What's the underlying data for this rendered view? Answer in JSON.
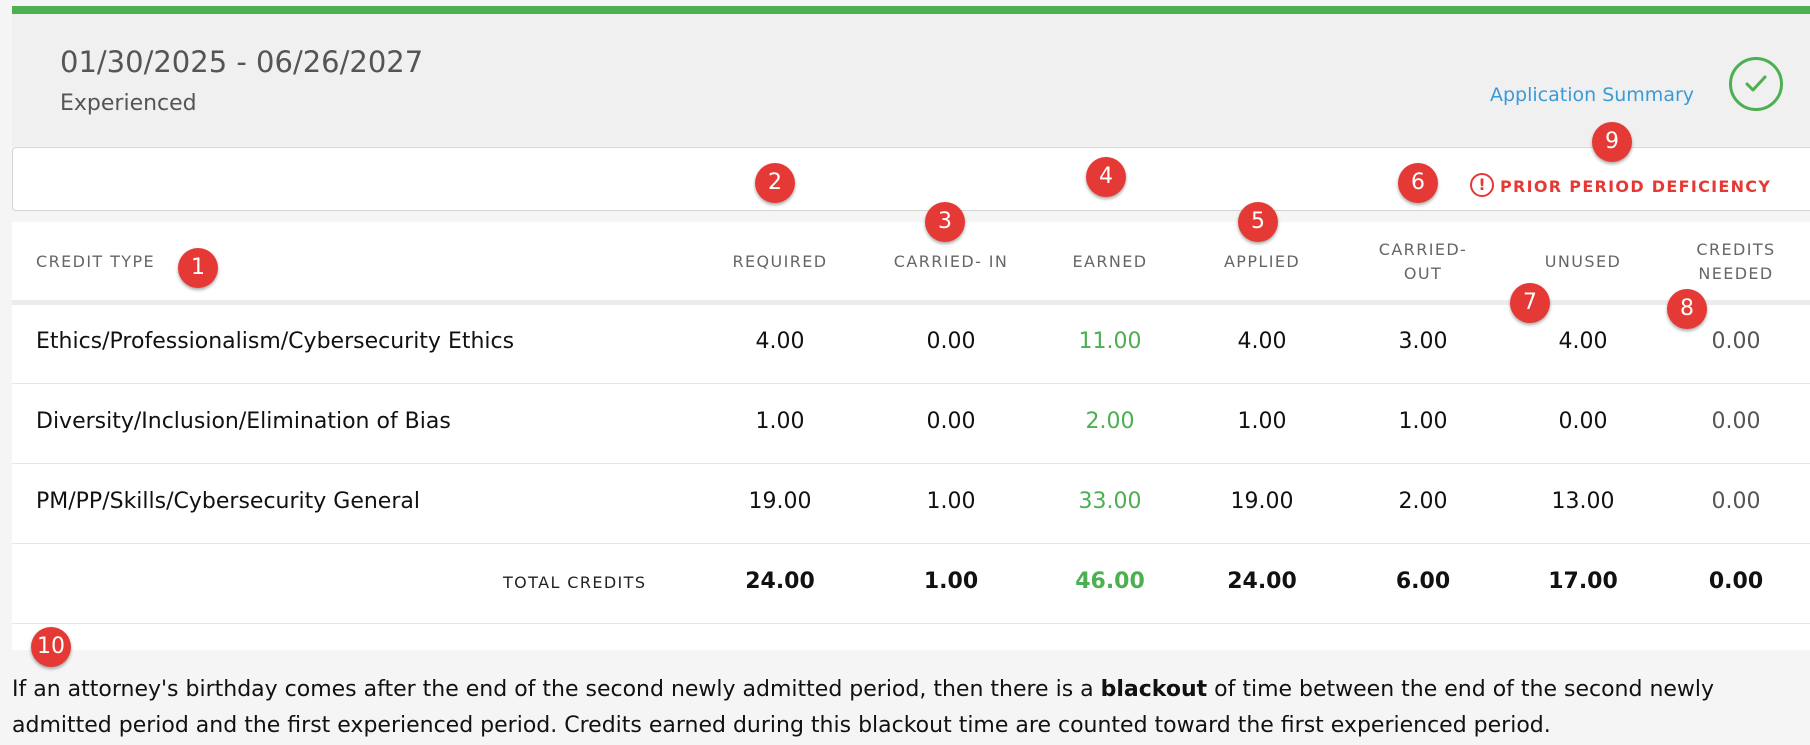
{
  "header": {
    "period": "01/30/2025 - 06/26/2027",
    "status": "Experienced",
    "app_summary_link": "Application Summary",
    "status_icon": "check-circle-icon",
    "accent_color": "#4caf50"
  },
  "deficiency": {
    "icon": "exclamation-circle-icon",
    "label": "PRIOR PERIOD DEFICIENCY",
    "color": "#e53935"
  },
  "table": {
    "columns": {
      "credit_type": "CREDIT TYPE",
      "required": "REQUIRED",
      "carried_in": "CARRIED- IN",
      "earned": "EARNED",
      "applied": "APPLIED",
      "carried_out_1": "CARRIED-",
      "carried_out_2": "OUT",
      "unused": "UNUSED",
      "needed_1": "CREDITS",
      "needed_2": "NEEDED"
    },
    "rows": [
      {
        "type": "Ethics/Professionalism/Cybersecurity Ethics",
        "required": "4.00",
        "carried_in": "0.00",
        "earned": "11.00",
        "applied": "4.00",
        "carried_out": "3.00",
        "unused": "4.00",
        "needed": "0.00"
      },
      {
        "type": "Diversity/Inclusion/Elimination of Bias",
        "required": "1.00",
        "carried_in": "0.00",
        "earned": "2.00",
        "applied": "1.00",
        "carried_out": "1.00",
        "unused": "0.00",
        "needed": "0.00"
      },
      {
        "type": "PM/PP/Skills/Cybersecurity General",
        "required": "19.00",
        "carried_in": "1.00",
        "earned": "33.00",
        "applied": "19.00",
        "carried_out": "2.00",
        "unused": "13.00",
        "needed": "0.00"
      }
    ],
    "totals": {
      "label": "TOTAL CREDITS",
      "required": "24.00",
      "carried_in": "1.00",
      "earned": "46.00",
      "applied": "24.00",
      "carried_out": "6.00",
      "unused": "17.00",
      "needed": "0.00"
    }
  },
  "badges": [
    "1",
    "2",
    "3",
    "4",
    "5",
    "6",
    "7",
    "8",
    "9",
    "10"
  ],
  "note": {
    "part1": "If an attorney's birthday comes after the end of the second newly admitted period, then there is a ",
    "bold": "blackout",
    "part2": " of time between the end of the second newly admitted period and the first experienced period. Credits earned during this blackout time are counted toward the first experienced period."
  }
}
